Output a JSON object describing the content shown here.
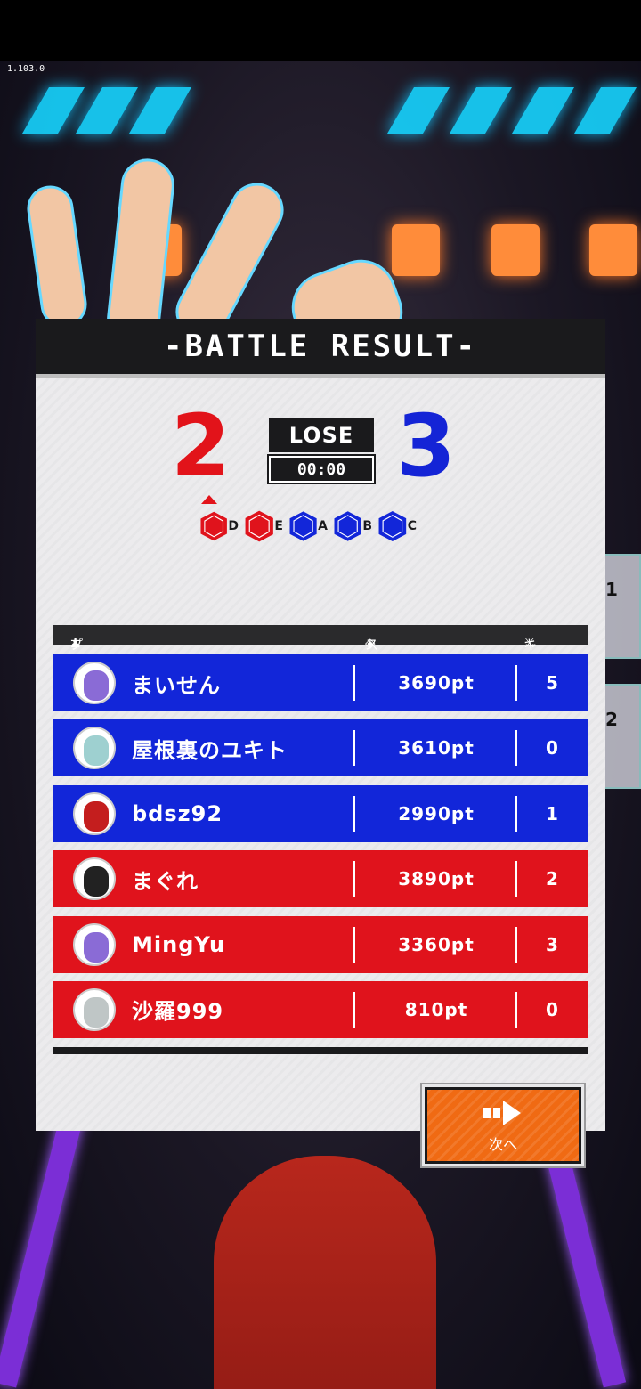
{
  "version": "1.103.0",
  "header": {
    "title": "-BATTLE RESULT-"
  },
  "match": {
    "our_score": "2",
    "enemy_score": "3",
    "result": "LOSE",
    "time": "00:00",
    "colors": {
      "red_team": "#e0131c",
      "blue_team": "#1226d9",
      "next_button": "#f06a13"
    }
  },
  "zones": [
    {
      "label": "D",
      "team": "red"
    },
    {
      "label": "E",
      "team": "red"
    },
    {
      "label": "A",
      "team": "blue"
    },
    {
      "label": "B",
      "team": "blue"
    },
    {
      "label": "C",
      "team": "blue"
    }
  ],
  "columns": {
    "player": "プレイヤー名",
    "score": "スコア",
    "kill": "キル"
  },
  "players": [
    {
      "name": "まいせん",
      "score": "3690pt",
      "kills": "5",
      "team": "blue"
    },
    {
      "name": "屋根裏のユキト",
      "score": "3610pt",
      "kills": "0",
      "team": "blue"
    },
    {
      "name": "bdsz92",
      "score": "2990pt",
      "kills": "1",
      "team": "blue"
    },
    {
      "name": "まぐれ",
      "score": "3890pt",
      "kills": "2",
      "team": "red"
    },
    {
      "name": "MingYu",
      "score": "3360pt",
      "kills": "3",
      "team": "red"
    },
    {
      "name": "沙羅999",
      "score": "810pt",
      "kills": "0",
      "team": "red"
    }
  ],
  "next_button": {
    "label": "次へ"
  },
  "side_tabs": [
    "1",
    "2"
  ]
}
